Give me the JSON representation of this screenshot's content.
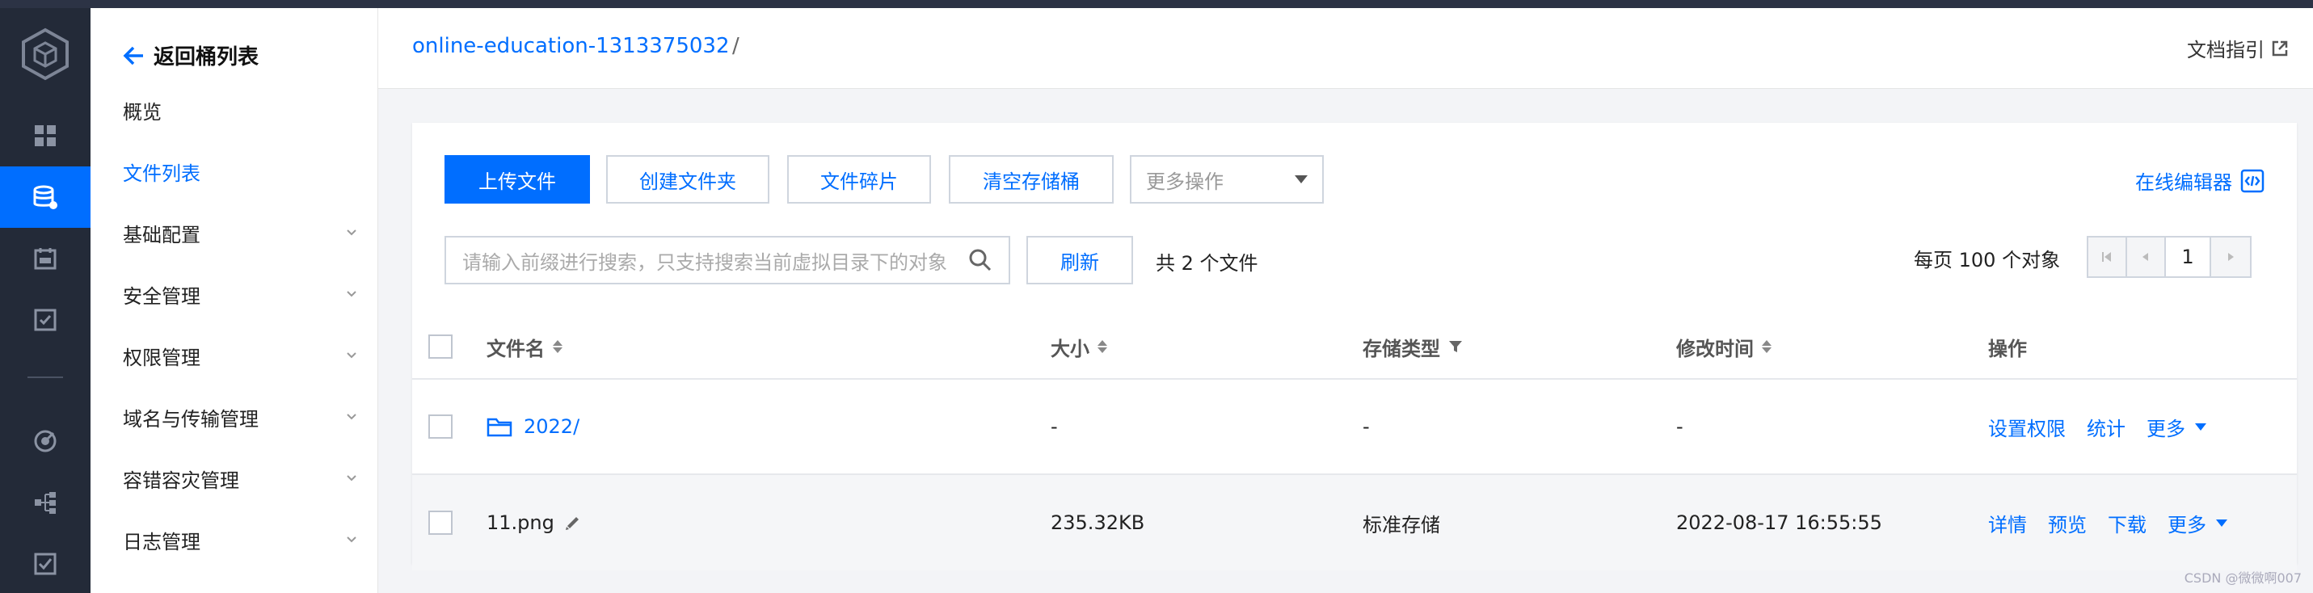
{
  "colors": {
    "accent": "#006eff",
    "rail_bg": "#232a38",
    "topbar": "#2c3345"
  },
  "rail": {
    "icons": [
      "dashboard-icon",
      "bucket-icon",
      "calendar-icon",
      "task-check-icon",
      "monitor-icon",
      "tree-icon",
      "checkbox-icon"
    ]
  },
  "sidebar": {
    "back_label": "返回桶列表",
    "items": [
      {
        "label": "概览",
        "expandable": false
      },
      {
        "label": "文件列表",
        "expandable": false,
        "active": true
      },
      {
        "label": "基础配置",
        "expandable": true
      },
      {
        "label": "安全管理",
        "expandable": true
      },
      {
        "label": "权限管理",
        "expandable": true
      },
      {
        "label": "域名与传输管理",
        "expandable": true
      },
      {
        "label": "容错容灾管理",
        "expandable": true
      },
      {
        "label": "日志管理",
        "expandable": true
      }
    ]
  },
  "header": {
    "bucket_name": "online-education-1313375032",
    "separator": "/",
    "docs_link": "文档指引"
  },
  "toolbar": {
    "upload": "上传文件",
    "create_folder": "创建文件夹",
    "fragments": "文件碎片",
    "clear_bucket": "清空存储桶",
    "more_actions": "更多操作",
    "online_editor": "在线编辑器"
  },
  "search": {
    "placeholder": "请输入前缀进行搜索，只支持搜索当前虚拟目录下的对象",
    "refresh": "刷新",
    "total": "共 2 个文件"
  },
  "pagination": {
    "per_page": "每页 100 个对象",
    "current_page": "1"
  },
  "table": {
    "columns": {
      "name": "文件名",
      "size": "大小",
      "storage": "存储类型",
      "modified": "修改时间",
      "actions": "操作"
    },
    "rows": [
      {
        "name": "2022/",
        "type": "folder",
        "size": "-",
        "storage": "-",
        "modified": "-",
        "actions": [
          "设置权限",
          "统计"
        ],
        "more": "更多"
      },
      {
        "name": "11.png",
        "type": "file",
        "size": "235.32KB",
        "storage": "标准存储",
        "modified": "2022-08-17 16:55:55",
        "actions": [
          "详情",
          "预览",
          "下载"
        ],
        "more": "更多"
      }
    ]
  },
  "watermark": "CSDN @微微啊007"
}
